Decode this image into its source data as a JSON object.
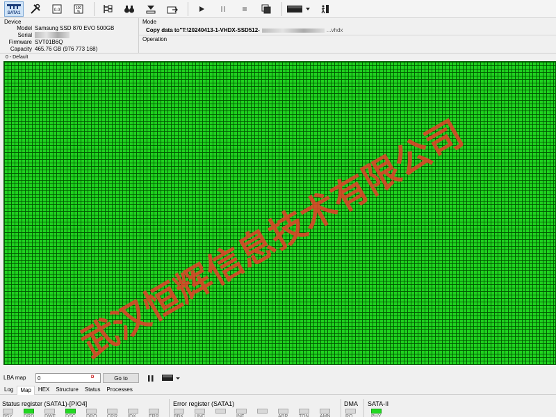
{
  "toolbar": {
    "port_label": "SATA1",
    "buttons": [
      "port-sata1",
      "tools",
      "sector-editor",
      "sector-hex",
      "structure",
      "search",
      "defect",
      "export",
      "start",
      "pause",
      "stop",
      "copy",
      "map-palette",
      "exit"
    ]
  },
  "device": {
    "section_title": "Device",
    "model_label": "Model",
    "model": "Samsung SSD 870 EVO 500GB",
    "serial_label": "Serial",
    "serial": "",
    "firmware_label": "Firmware",
    "firmware": "SVT01B6Q",
    "capacity_label": "Capacity",
    "capacity": "465.76 GB (976 773 168)"
  },
  "mode": {
    "section_title": "Mode",
    "value": "Copy data to\"T:\\20240413-1-VHDX-SSD512-",
    "value_tail": "...vhdx",
    "operation_label": "Operation"
  },
  "map": {
    "title": "0 - Default",
    "cell_color": "#1fd21f",
    "grid_color": "#005500"
  },
  "watermark": {
    "text": "武汉恒辉信息技术有限公司",
    "color": "#e8402a"
  },
  "lba": {
    "label": "LBA map",
    "value": "0",
    "dec_badge": "D",
    "goto_label": "Go to"
  },
  "tabs": [
    {
      "label": "Log"
    },
    {
      "label": "Map"
    },
    {
      "label": "HEX"
    },
    {
      "label": "Structure"
    },
    {
      "label": "Status"
    },
    {
      "label": "Processes"
    }
  ],
  "status_register": {
    "title": "Status register (SATA1)-[PIO4]",
    "items": [
      {
        "name": "BSY",
        "on": false
      },
      {
        "name": "DRD",
        "on": true
      },
      {
        "name": "DWF",
        "on": false
      },
      {
        "name": "DSC",
        "on": true
      },
      {
        "name": "DRQ",
        "on": false
      },
      {
        "name": "CRR",
        "on": false
      },
      {
        "name": "IDX",
        "on": false
      },
      {
        "name": "ERR",
        "on": false
      }
    ]
  },
  "error_register": {
    "title": "Error register (SATA1)",
    "items": [
      {
        "name": "BBK",
        "on": false
      },
      {
        "name": "UNC",
        "on": false
      },
      {
        "name": "",
        "on": false
      },
      {
        "name": "INF",
        "on": false
      },
      {
        "name": "",
        "on": false
      },
      {
        "name": "ABR",
        "on": false
      },
      {
        "name": "TON",
        "on": false
      },
      {
        "name": "AMN",
        "on": false
      }
    ]
  },
  "dma": {
    "title": "DMA",
    "items": [
      {
        "name": "RQ",
        "on": false
      }
    ]
  },
  "sata": {
    "title": "SATA-II",
    "items": [
      {
        "name": "PHY",
        "on": true
      }
    ]
  }
}
